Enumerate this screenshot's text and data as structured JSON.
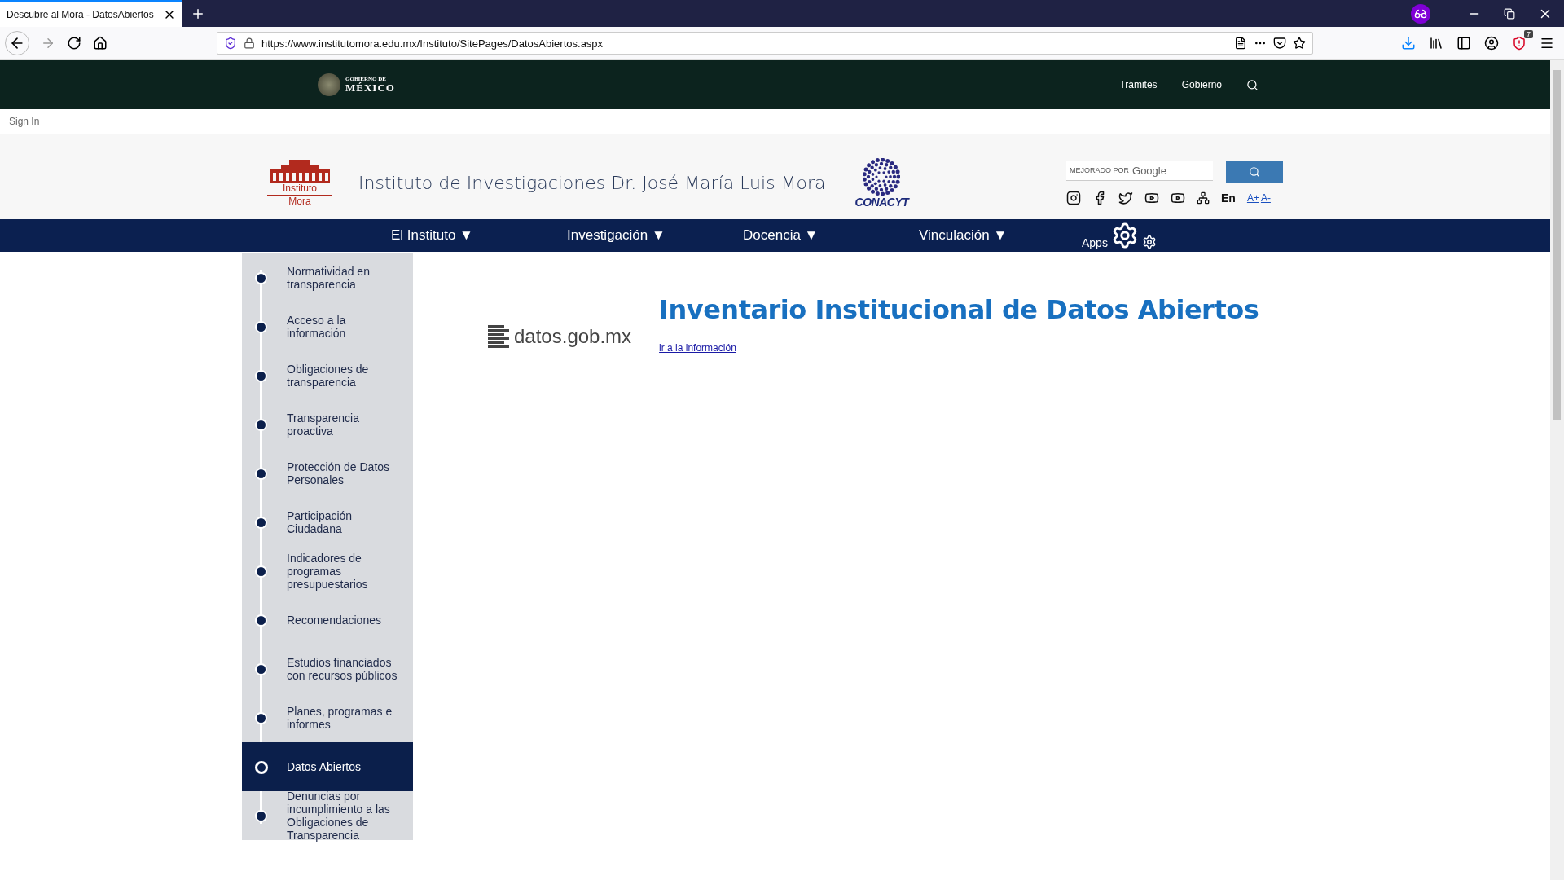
{
  "browser": {
    "tab_title": "Descubre al Mora - DatosAbiertos",
    "url": "https://www.institutomora.edu.mx/Instituto/SitePages/DatosAbiertos.aspx",
    "extension_badge": "7"
  },
  "gov_bar": {
    "logo_top": "GOBIERNO DE",
    "logo_bottom": "MÉXICO",
    "links": [
      "Trámites",
      "Gobierno"
    ]
  },
  "sign_in": "Sign In",
  "header": {
    "logo_top": "Instituto",
    "logo_bottom": "Mora",
    "title": "Instituto de Investigaciones Dr. José María Luis Mora",
    "partner_logo": "CONACYT",
    "search": {
      "placeholder_prefix": "MEJORADO POR",
      "placeholder_brand": "Google"
    },
    "language": "En",
    "font_up": "A+",
    "font_down": "A-"
  },
  "nav": {
    "items": [
      {
        "label": "El Instituto",
        "caret": "▼"
      },
      {
        "label": "Investigación",
        "caret": "▼"
      },
      {
        "label": "Docencia",
        "caret": "▼"
      },
      {
        "label": "Vinculación",
        "caret": "▼"
      }
    ],
    "apps": "Apps"
  },
  "sidebar": {
    "items": [
      {
        "label": "Normatividad en transparencia",
        "selected": false
      },
      {
        "label": "Acceso a la información",
        "selected": false
      },
      {
        "label": "Obligaciones de transparencia",
        "selected": false
      },
      {
        "label": "Transparencia proactiva",
        "selected": false
      },
      {
        "label": "Protección de Datos Personales",
        "selected": false
      },
      {
        "label": "Participación Ciudadana",
        "selected": false
      },
      {
        "label": "Indicadores de programas presupuestarios",
        "selected": false
      },
      {
        "label": "Recomendaciones",
        "selected": false
      },
      {
        "label": "Estudios financiados con recursos públicos",
        "selected": false
      },
      {
        "label": "Planes, programas e informes",
        "selected": false
      },
      {
        "label": "Datos Abiertos",
        "selected": true
      },
      {
        "label": "Denuncias por incumplimiento a las Obligaciones de Transparencia",
        "selected": false
      }
    ]
  },
  "content": {
    "logo_text": "datos.gob.mx",
    "title": "Inventario Institucional de Datos Abiertos",
    "link": "ir a la información"
  }
}
